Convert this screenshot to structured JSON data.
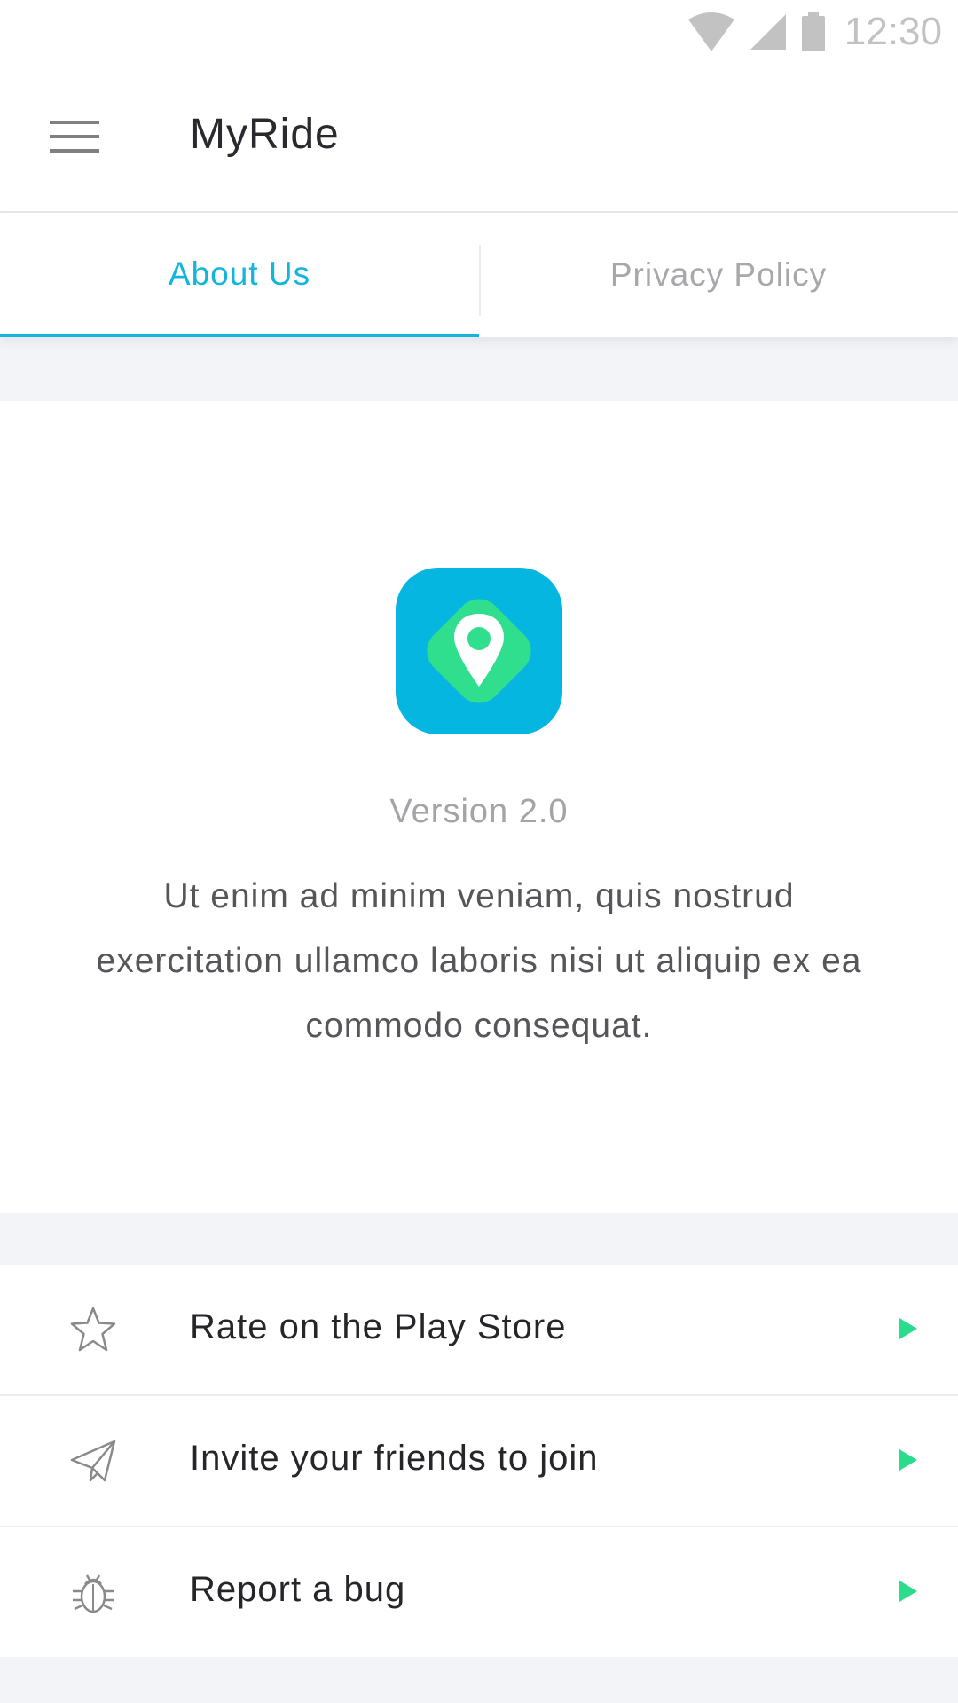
{
  "status_bar": {
    "time": "12:30",
    "icons": [
      "wifi-icon",
      "signal-icon",
      "battery-icon"
    ]
  },
  "app_bar": {
    "title": "MyRide",
    "menu_icon": "menu-icon"
  },
  "tabs": [
    {
      "label": "About Us",
      "active": true
    },
    {
      "label": "Privacy Policy",
      "active": false
    }
  ],
  "about": {
    "logo_icon": "location-pin-icon",
    "version": "Version 2.0",
    "description": "Ut enim ad minim veniam, quis nostrud exercitation ullamco laboris nisi ut aliquip ex ea commodo consequat."
  },
  "actions": [
    {
      "label": "Rate on the Play Store",
      "icon": "star-icon"
    },
    {
      "label": "Invite your friends to join",
      "icon": "paper-plane-icon"
    },
    {
      "label": "Report a bug",
      "icon": "bug-icon"
    }
  ],
  "colors": {
    "accent": "#12b5dc",
    "brand_green": "#2bdc8c",
    "background": "#f3f4f8"
  }
}
